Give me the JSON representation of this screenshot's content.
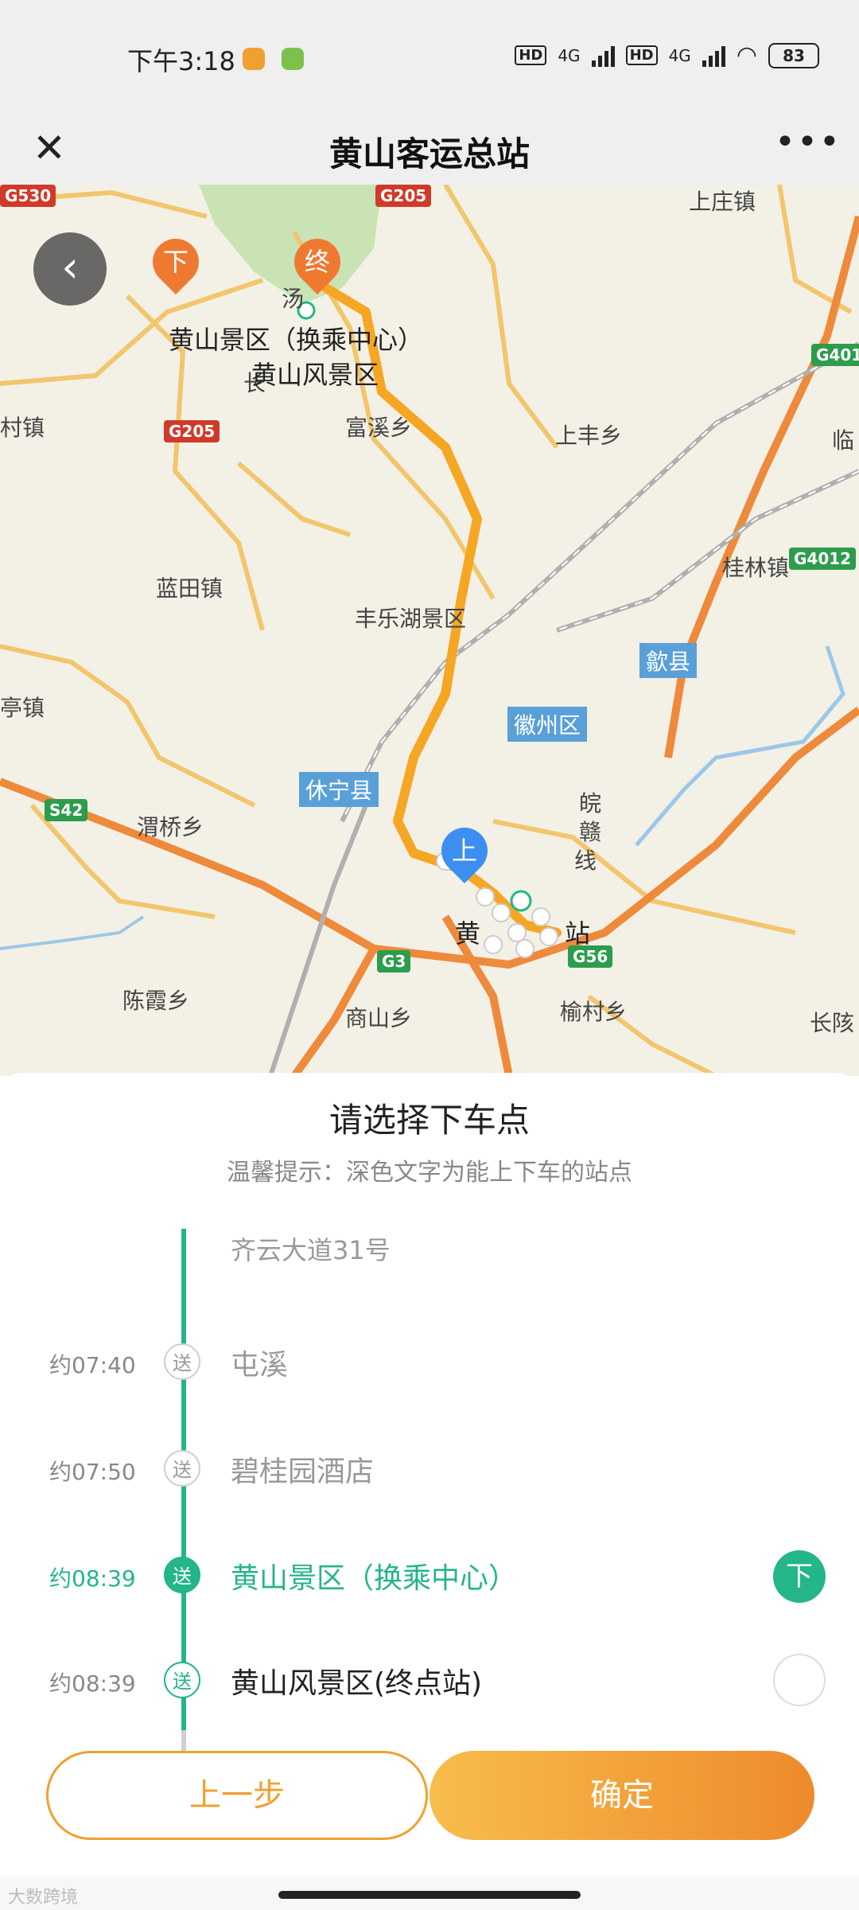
{
  "status_bar": {
    "time": "下午3:18",
    "hd1": "HD",
    "net1": "4G",
    "hd2": "HD",
    "net2": "4G",
    "battery": "83"
  },
  "title_bar": {
    "title": "黄山客运总站",
    "close_icon": "close-icon",
    "more": "•••"
  },
  "map": {
    "labels": {
      "upper_town": "上庄镇",
      "terminal_center": "黄山景区（换乘中心）",
      "scenic_area": "黄山风景区",
      "tang": "汤",
      "chang": "长",
      "fuxi": "富溪乡",
      "shangfeng": "上丰乡",
      "cun_town": "村镇",
      "lin": "临",
      "guilin": "桂林镇",
      "lantian": "蓝田镇",
      "fengle": "丰乐湖景区",
      "shexian": "歙县",
      "huizhou": "徽州区",
      "ting": "亭镇",
      "xiuning": "休宁县",
      "weiqiao": "渭桥乡",
      "wan": "皖",
      "gan": "赣",
      "xian": "线",
      "huang": "黄",
      "zhan": "站",
      "chenxia": "陈霞乡",
      "shangshan": "商山乡",
      "yucun": "榆村乡",
      "changgai": "长陔"
    },
    "road_badges": {
      "g530": "G530",
      "g205a": "G205",
      "g205b": "G205",
      "g401": "G401",
      "g4012": "G4012",
      "g3": "G3",
      "g56": "G56",
      "s42": "S42"
    },
    "pins": {
      "end": "终",
      "drop": "下",
      "board": "上"
    }
  },
  "sheet": {
    "title": "请选择下车点",
    "tip": "温馨提示：深色文字为能上下车的站点",
    "stops": [
      {
        "time": "",
        "badge": "",
        "name": "齐云大道31号"
      },
      {
        "time": "约07:40",
        "badge": "送",
        "name": "屯溪"
      },
      {
        "time": "约07:50",
        "badge": "送",
        "name": "碧桂园酒店"
      },
      {
        "time": "约08:39",
        "badge": "送",
        "name": "黄山景区（换乘中心）",
        "selected_mark": "下"
      },
      {
        "time": "约08:39",
        "badge": "送",
        "name": "黄山风景区(终点站)"
      }
    ],
    "prev_button": "上一步",
    "confirm_button": "确定"
  },
  "watermark": "大数跨境",
  "colors": {
    "accent": "#24b58a",
    "orange": "#f0a030",
    "route": "#f5a623"
  }
}
